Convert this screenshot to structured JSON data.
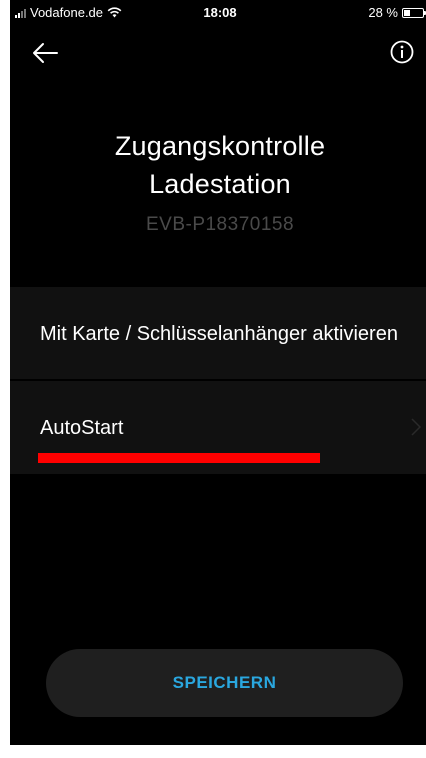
{
  "status_bar": {
    "carrier": "Vodafone.de",
    "time": "18:08",
    "battery": "28 %",
    "battery_level_percent": 28
  },
  "header": {
    "back_icon": "arrow-left-icon",
    "info_icon": "info-circle-icon"
  },
  "page": {
    "title_line1": "Zugangskontrolle",
    "title_line2": "Ladestation",
    "device_id": "EVB-P18370158"
  },
  "options": [
    {
      "label": "Mit Karte / Schlüsselanhänger aktivieren"
    },
    {
      "label": "AutoStart",
      "icon": "chevron-right-icon"
    }
  ],
  "actions": {
    "save_label": "SPEICHERN"
  },
  "colors": {
    "background": "#000000",
    "row_background": "#111111",
    "accent": "#2aa7df",
    "highlight": "#ff0000",
    "muted_text": "#4a4a4a"
  }
}
